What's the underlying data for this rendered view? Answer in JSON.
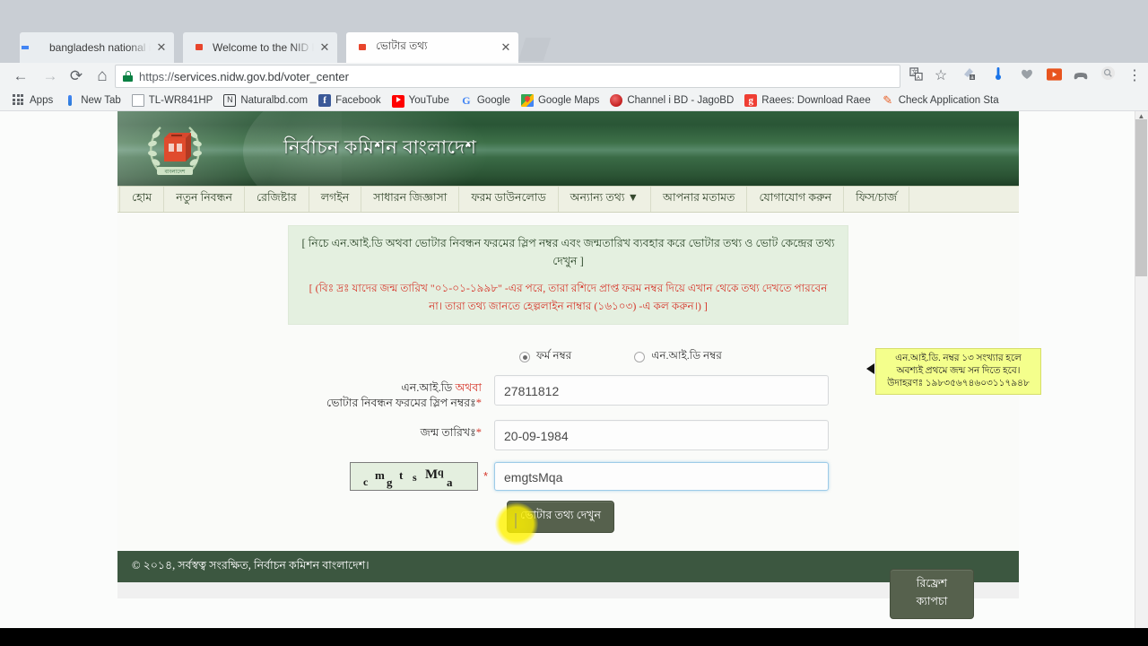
{
  "browser": {
    "tabs": [
      {
        "title": "bangladesh national id c",
        "favicon": "google-g-icon",
        "active": false
      },
      {
        "title": "Welcome to the NID Reg",
        "favicon": "nid-crest-icon",
        "active": false
      },
      {
        "title": "ভোটার তথ্য",
        "favicon": "nid-crest-icon",
        "active": true
      }
    ],
    "nav": {
      "back": "←",
      "forward": "→",
      "reload": "⟳",
      "home": "⌂"
    },
    "omnibox": {
      "lock": "lock-icon",
      "scheme": "https://",
      "url": "services.nidw.gov.bd/voter_center",
      "full_url": "https://services.nidw.gov.bd/voter_center"
    },
    "toolbar_icons": [
      "translate-icon",
      "bookmark-star-icon",
      "extension-icon",
      "thermometer-icon",
      "heart-icon",
      "youtube-icon",
      "controller-icon",
      "search-circle-icon",
      "menu-kebab-icon"
    ],
    "bookmarks": [
      {
        "label": "Apps",
        "icon": "apps-grid-icon"
      },
      {
        "label": "New Tab",
        "icon": "newtab-icon"
      },
      {
        "label": "TL-WR841HP",
        "icon": "page-icon"
      },
      {
        "label": "Naturalbd.com",
        "icon": "letter-n-icon"
      },
      {
        "label": "Facebook",
        "icon": "facebook-icon"
      },
      {
        "label": "YouTube",
        "icon": "youtube-icon"
      },
      {
        "label": "Google",
        "icon": "google-g-icon"
      },
      {
        "label": "Google Maps",
        "icon": "google-maps-icon"
      },
      {
        "label": "Channel i BD - JagoBD",
        "icon": "channel-i-icon"
      },
      {
        "label": "Raees: Download Raee",
        "icon": "raees-icon"
      },
      {
        "label": "Check Application Sta",
        "icon": "check-app-icon"
      }
    ]
  },
  "site": {
    "title": "নির্বাচন কমিশন বাংলাদেশ",
    "crest_alt": "bangladesh-election-commission-crest",
    "nav_items": [
      "হোম",
      "নতুন নিবন্ধন",
      "রেজিষ্টার",
      "লগইন",
      "সাধারন জিজ্ঞাসা",
      "ফরম ডাউনলোড",
      "অন্যান্য তথ্য ▼",
      "আপনার মতামত",
      "যোগাযোগ করুন",
      "ফিস/চার্জ"
    ],
    "notice": {
      "line1": "[ নিচে এন.আই.ডি অথবা ভোটার নিবন্ধন ফরমের স্লিপ নম্বর এবং জন্মতারিখ ব্যবহার করে ভোটার তথ্য ও ভোট কেন্দ্রের তথ্য দেখুন ]",
      "line2": "[ (বিঃ দ্রঃ যাদের জন্ম তারিখ \"০১-০১-১৯৯৮\" -এর পরে, তারা রশিদে প্রাপ্ত ফরম নম্বর দিয়ে এখান থেকে তথ্য দেখতে পারবেন না। তারা তথ্য জানতে হেল্পলাইন নাম্বার (১৬১০৩) -এ কল করুন।) ]"
    },
    "form": {
      "radio_options": [
        {
          "label": "ফর্ম নম্বর",
          "checked": true
        },
        {
          "label": "এন.আই.ডি নম্বর",
          "checked": false
        }
      ],
      "nid_label_line1_a": "এন.আই.ডি ",
      "nid_label_line1_b": "অথবা",
      "nid_label_line2": "ভোটার নিবন্ধন ফরমের স্লিপ নম্বরঃ",
      "nid_value": "27811812",
      "nid_placeholder": "",
      "dob_label": "জন্ম তারিখঃ",
      "dob_value": "20-09-1984",
      "dob_placeholder": "",
      "captcha_chars": [
        "c",
        "m",
        "g",
        "t",
        "s",
        "M",
        "q",
        "a"
      ],
      "captcha_text": "cmgtsMqa",
      "captcha_value": "emgtsMqa",
      "captcha_placeholder": "",
      "captcha_required_mark": "*",
      "refresh_captcha_label": "রিফ্রেশ ক্যাপচা",
      "submit_label": "ভোটার তথ্য দেখুন",
      "required_mark": "*"
    },
    "tooltip": {
      "line1": "এন.আই.ডি. নম্বর ১৩ সংখ্যার হলে",
      "line2": "অবশ্যই প্রথমে জন্ম সন দিতে হবে।",
      "line3": "উদাহরণঃ ১৯৮৩৫৬৭৪৬০৩১১৭৯৪৮"
    },
    "footer": "© ২০১৪, সর্বস্বত্ব সংরক্ষিত, নির্বাচন কমিশন বাংলাদেশ।"
  },
  "colors": {
    "header_green": "#2f5f3c",
    "nav_bg": "#eef0e3",
    "notice_bg": "#e4f0e0",
    "notice_red": "#d6372b",
    "tooltip_yellow": "#f4ff8c",
    "button_green": "#56614d",
    "footer_green": "#3c5740"
  }
}
